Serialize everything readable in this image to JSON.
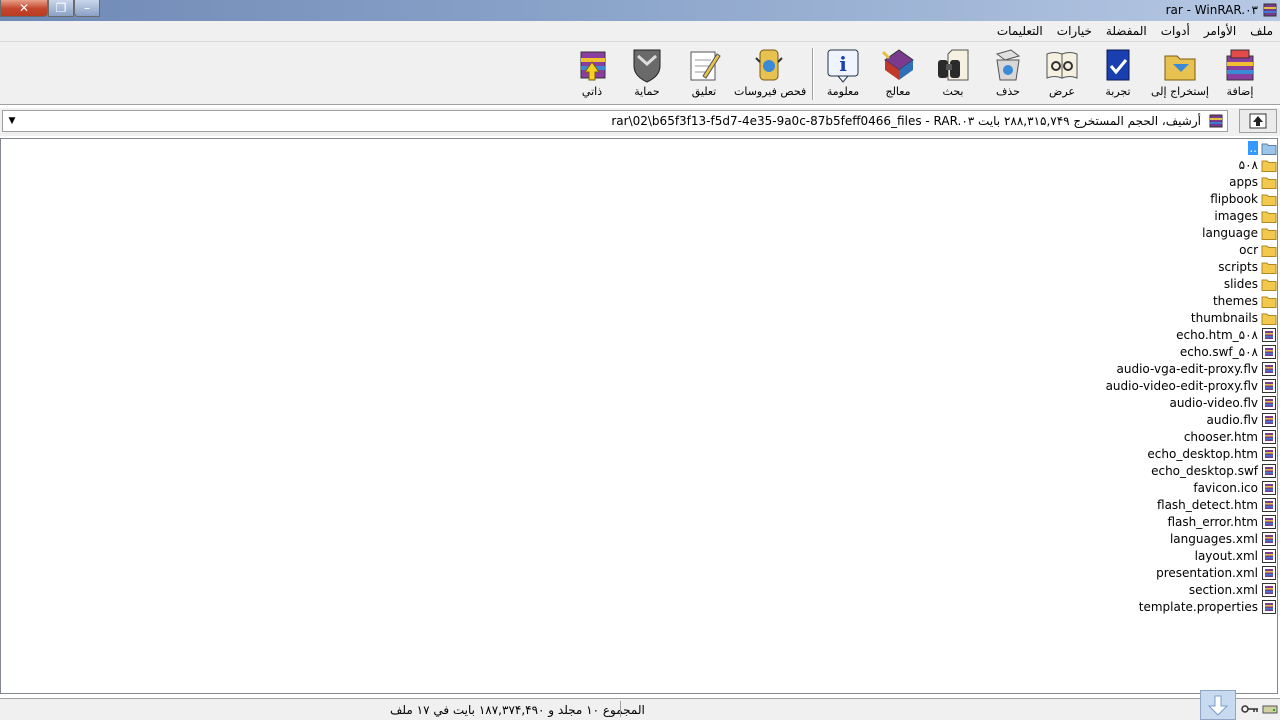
{
  "window": {
    "title": "rar - WinRAR.۰۳",
    "close_label": "✕",
    "max_label": "❐",
    "min_label": "–"
  },
  "menu": [
    "ملف",
    "الأوامر",
    "أدوات",
    "المفضلة",
    "خيارات",
    "التعليمات"
  ],
  "toolbar": [
    {
      "label": "إضافة",
      "icon": "add-archive-icon"
    },
    {
      "label": "إستخراج إلى",
      "icon": "extract-to-icon"
    },
    {
      "label": "تجربة",
      "icon": "test-icon"
    },
    {
      "label": "عرض",
      "icon": "view-icon"
    },
    {
      "label": "حذف",
      "icon": "delete-icon"
    },
    {
      "label": "بحث",
      "icon": "find-icon"
    },
    {
      "label": "معالج",
      "icon": "wizard-icon"
    },
    {
      "label": "معلومة",
      "icon": "info-icon"
    },
    {
      "label": "فحص فيروسات",
      "icon": "virus-scan-icon"
    },
    {
      "label": "تعليق",
      "icon": "comment-icon"
    },
    {
      "label": "حماية",
      "icon": "protect-icon"
    },
    {
      "label": "ذاتي",
      "icon": "sfx-icon"
    }
  ],
  "address": {
    "text": "rar\\02\\b65f3f13-f5d7-4e35-9a0c-87b5feff0466_files - RAR.۰۳ أرشيف، الحجم المستخرج ۲۸۸,۳۱۵,۷۴۹ بايت"
  },
  "files": [
    {
      "name": "..",
      "type": "up"
    },
    {
      "name": "۵۰۸",
      "type": "folder"
    },
    {
      "name": "apps",
      "type": "folder"
    },
    {
      "name": "flipbook",
      "type": "folder"
    },
    {
      "name": "images",
      "type": "folder"
    },
    {
      "name": "language",
      "type": "folder"
    },
    {
      "name": "ocr",
      "type": "folder"
    },
    {
      "name": "scripts",
      "type": "folder"
    },
    {
      "name": "slides",
      "type": "folder"
    },
    {
      "name": "themes",
      "type": "folder"
    },
    {
      "name": "thumbnails",
      "type": "folder"
    },
    {
      "name": "echo.htm_۵۰۸",
      "type": "file"
    },
    {
      "name": "echo.swf_۵۰۸",
      "type": "file"
    },
    {
      "name": "audio-vga-edit-proxy.flv",
      "type": "file"
    },
    {
      "name": "audio-video-edit-proxy.flv",
      "type": "file"
    },
    {
      "name": "audio-video.flv",
      "type": "file"
    },
    {
      "name": "audio.flv",
      "type": "file"
    },
    {
      "name": "chooser.htm",
      "type": "file"
    },
    {
      "name": "echo_desktop.htm",
      "type": "file"
    },
    {
      "name": "echo_desktop.swf",
      "type": "file"
    },
    {
      "name": "favicon.ico",
      "type": "file"
    },
    {
      "name": "flash_detect.htm",
      "type": "file"
    },
    {
      "name": "flash_error.htm",
      "type": "file"
    },
    {
      "name": "languages.xml",
      "type": "file"
    },
    {
      "name": "layout.xml",
      "type": "file"
    },
    {
      "name": "presentation.xml",
      "type": "file"
    },
    {
      "name": "section.xml",
      "type": "file"
    },
    {
      "name": "template.properties",
      "type": "file"
    }
  ],
  "status": {
    "text": "المجموع ۱۰ مجلد و ۱۸۷,۳۷۴,۴۹۰ بايت في ۱۷ ملف"
  },
  "colors": {
    "selection": "#3399ff",
    "folder": "#f2c94c",
    "titlebar": "#8aa3c9"
  }
}
